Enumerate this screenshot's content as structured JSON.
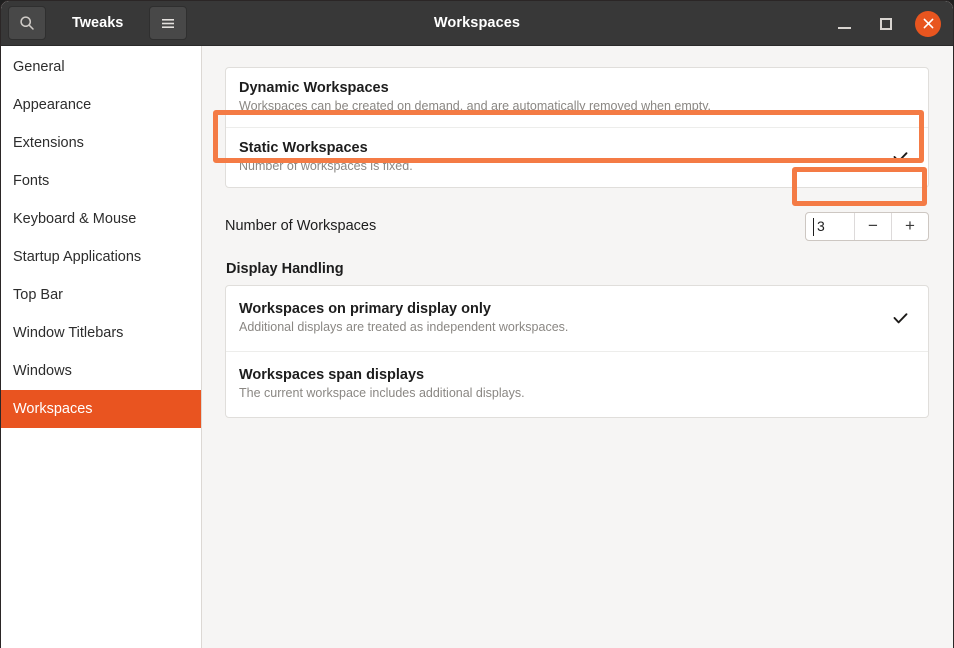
{
  "window": {
    "app_title": "Tweaks",
    "header_title": "Workspaces",
    "accent_color": "#e95420",
    "annotation_color": "#f47b45",
    "search_icon": "search-icon",
    "menu_icon": "hamburger-menu-icon",
    "minimize_label": "Minimize",
    "maximize_label": "Maximize",
    "close_label": "Close"
  },
  "sidebar": {
    "items": [
      {
        "label": "General",
        "selected": false
      },
      {
        "label": "Appearance",
        "selected": false
      },
      {
        "label": "Extensions",
        "selected": false
      },
      {
        "label": "Fonts",
        "selected": false
      },
      {
        "label": "Keyboard & Mouse",
        "selected": false
      },
      {
        "label": "Startup Applications",
        "selected": false
      },
      {
        "label": "Top Bar",
        "selected": false
      },
      {
        "label": "Window Titlebars",
        "selected": false
      },
      {
        "label": "Windows",
        "selected": false
      },
      {
        "label": "Workspaces",
        "selected": true
      }
    ]
  },
  "main": {
    "workspace_mode": {
      "options": [
        {
          "title": "Dynamic Workspaces",
          "subtitle": "Workspaces can be created on demand, and are automatically removed when empty.",
          "checked": false
        },
        {
          "title": "Static Workspaces",
          "subtitle": "Number of workspaces is fixed.",
          "checked": true
        }
      ]
    },
    "number_of_workspaces": {
      "label": "Number of Workspaces",
      "value": "3",
      "decrement_label": "−",
      "increment_label": "+"
    },
    "display_handling": {
      "heading": "Display Handling",
      "options": [
        {
          "title": "Workspaces on primary display only",
          "subtitle": "Additional displays are treated as independent workspaces.",
          "checked": true
        },
        {
          "title": "Workspaces span displays",
          "subtitle": "The current workspace includes additional displays.",
          "checked": false
        }
      ]
    }
  }
}
